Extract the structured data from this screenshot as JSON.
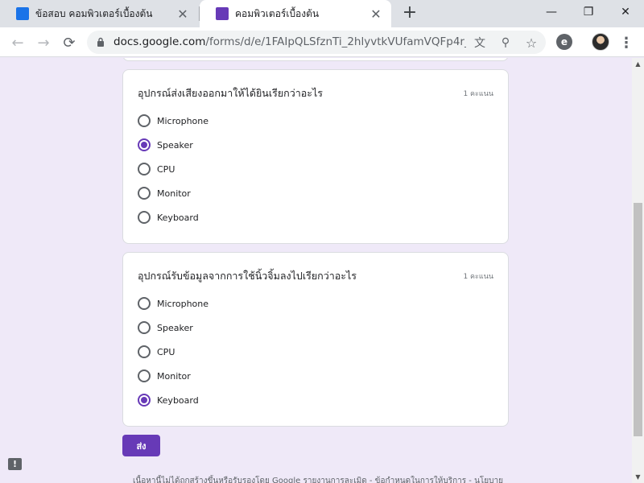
{
  "browser": {
    "tabs": [
      {
        "title": "ข้อสอบ คอมพิวเตอร์เบื้องต้น",
        "favicon": "classroom-icon",
        "active": false
      },
      {
        "title": "คอมพิวเตอร์เบื้องต้น",
        "favicon": "forms-icon",
        "active": true
      }
    ],
    "new_tab_glyph": "+",
    "window": {
      "minimize": "—",
      "maximize": "❐",
      "close": "✕"
    },
    "url_host": "docs.google.com",
    "url_path": "/forms/d/e/1FAIpQLSfznTi_2hlyvtkVUfamVQFp4r_D...",
    "nav": {
      "back": "←",
      "forward": "→",
      "reload": "⟳"
    },
    "omnibox_icons": {
      "translate": "文",
      "zoom": "⚲",
      "star": "☆"
    },
    "extension_label": "e",
    "menu_glyph": "⋮",
    "colors": {
      "accent": "#673ab7",
      "page_bg": "#efe9f8"
    }
  },
  "form": {
    "questions": [
      {
        "title": "อุปกรณ์ส่งเสียงออกมาให้ได้ยินเรียกว่าอะไร",
        "points": "1 คะแนน",
        "options": [
          {
            "label": "Microphone",
            "checked": false
          },
          {
            "label": "Speaker",
            "checked": true
          },
          {
            "label": "CPU",
            "checked": false
          },
          {
            "label": "Monitor",
            "checked": false
          },
          {
            "label": "Keyboard",
            "checked": false
          }
        ]
      },
      {
        "title": "อุปกรณ์รับข้อมูลจากการใช้นิ้วจิ้มลงไปเรียกว่าอะไร",
        "points": "1 คะแนน",
        "options": [
          {
            "label": "Microphone",
            "checked": false
          },
          {
            "label": "Speaker",
            "checked": false
          },
          {
            "label": "CPU",
            "checked": false
          },
          {
            "label": "Monitor",
            "checked": false
          },
          {
            "label": "Keyboard",
            "checked": true
          }
        ]
      }
    ],
    "submit_label": "ส่ง",
    "footer": "เนื้อหานี้ไม่ได้ถูกสร้างขึ้นหรือรับรองโดย Google รายงานการละเมิด - ข้อกำหนดในการให้บริการ - นโยบายความเป็น",
    "feedback_glyph": "!"
  }
}
